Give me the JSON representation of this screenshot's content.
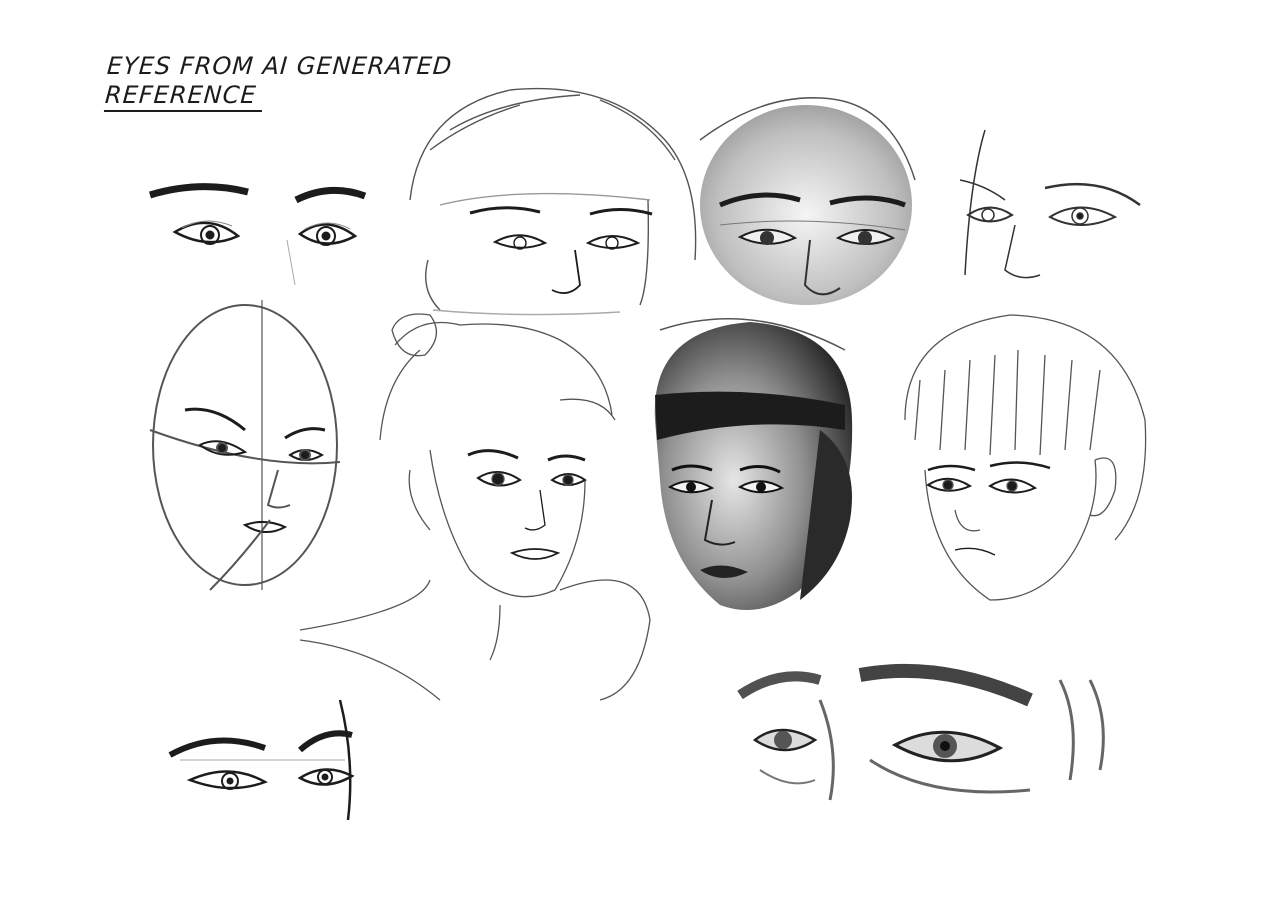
{
  "caption": {
    "line1": "EYES FROM AI GENERATED",
    "line2": "REFERENCE"
  },
  "palette": {
    "background": "#ffffff",
    "ink": "#1c1c1c",
    "pencil": "#6e6e6e",
    "shade": "#8a8a8a"
  }
}
